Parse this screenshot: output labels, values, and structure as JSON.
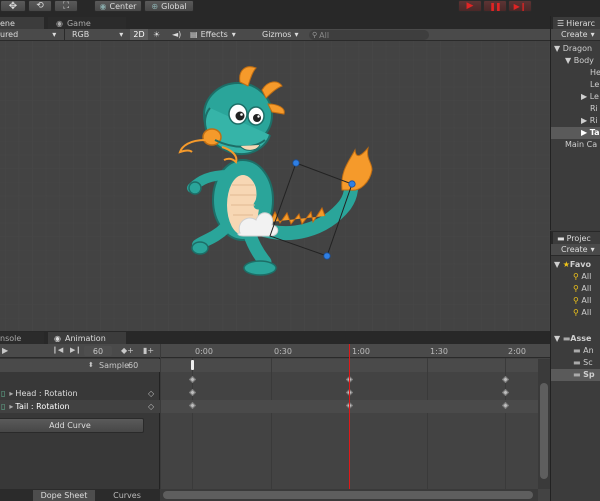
{
  "toolbar": {
    "pivot_label": "Center",
    "space_label": "Global"
  },
  "tabs": {
    "scene": "ene",
    "game": "Game",
    "hierarchy": "Hierarc",
    "console": "nsole",
    "animation": "Animation",
    "project": "Projec"
  },
  "scene_bar": {
    "shading": "ured",
    "render_mode": "RGB",
    "mode_2d": "2D",
    "effects": "Effects",
    "gizmos": "Gizmos",
    "search_placeholder": "All"
  },
  "hierarchy": {
    "create_label": "Create",
    "items": [
      "Dragon",
      "Body",
      "He",
      "Le",
      "Le",
      "Ri",
      "Ri",
      "Ta",
      "Main Ca"
    ]
  },
  "project": {
    "create_label": "Create",
    "favorites_label": "Favo",
    "favorites": [
      "All",
      "All",
      "All",
      "All"
    ],
    "assets_label": "Asse",
    "assets": [
      "An",
      "Sc",
      "Sp"
    ]
  },
  "animation": {
    "frame": "60",
    "sample_label": "Sample",
    "sample_value": "60",
    "properties": [
      "Head : Rotation",
      "Tail : Rotation"
    ],
    "add_curve": "Add Curve",
    "ruler": [
      "0:00",
      "0:30",
      "1:00",
      "1:30",
      "2:00"
    ],
    "view_tabs": [
      "Dope Sheet",
      "Curves"
    ]
  },
  "colors": {
    "playhead": "#e01818",
    "play_button": "#c01a1a",
    "handle_blue": "#2f7fe3"
  }
}
